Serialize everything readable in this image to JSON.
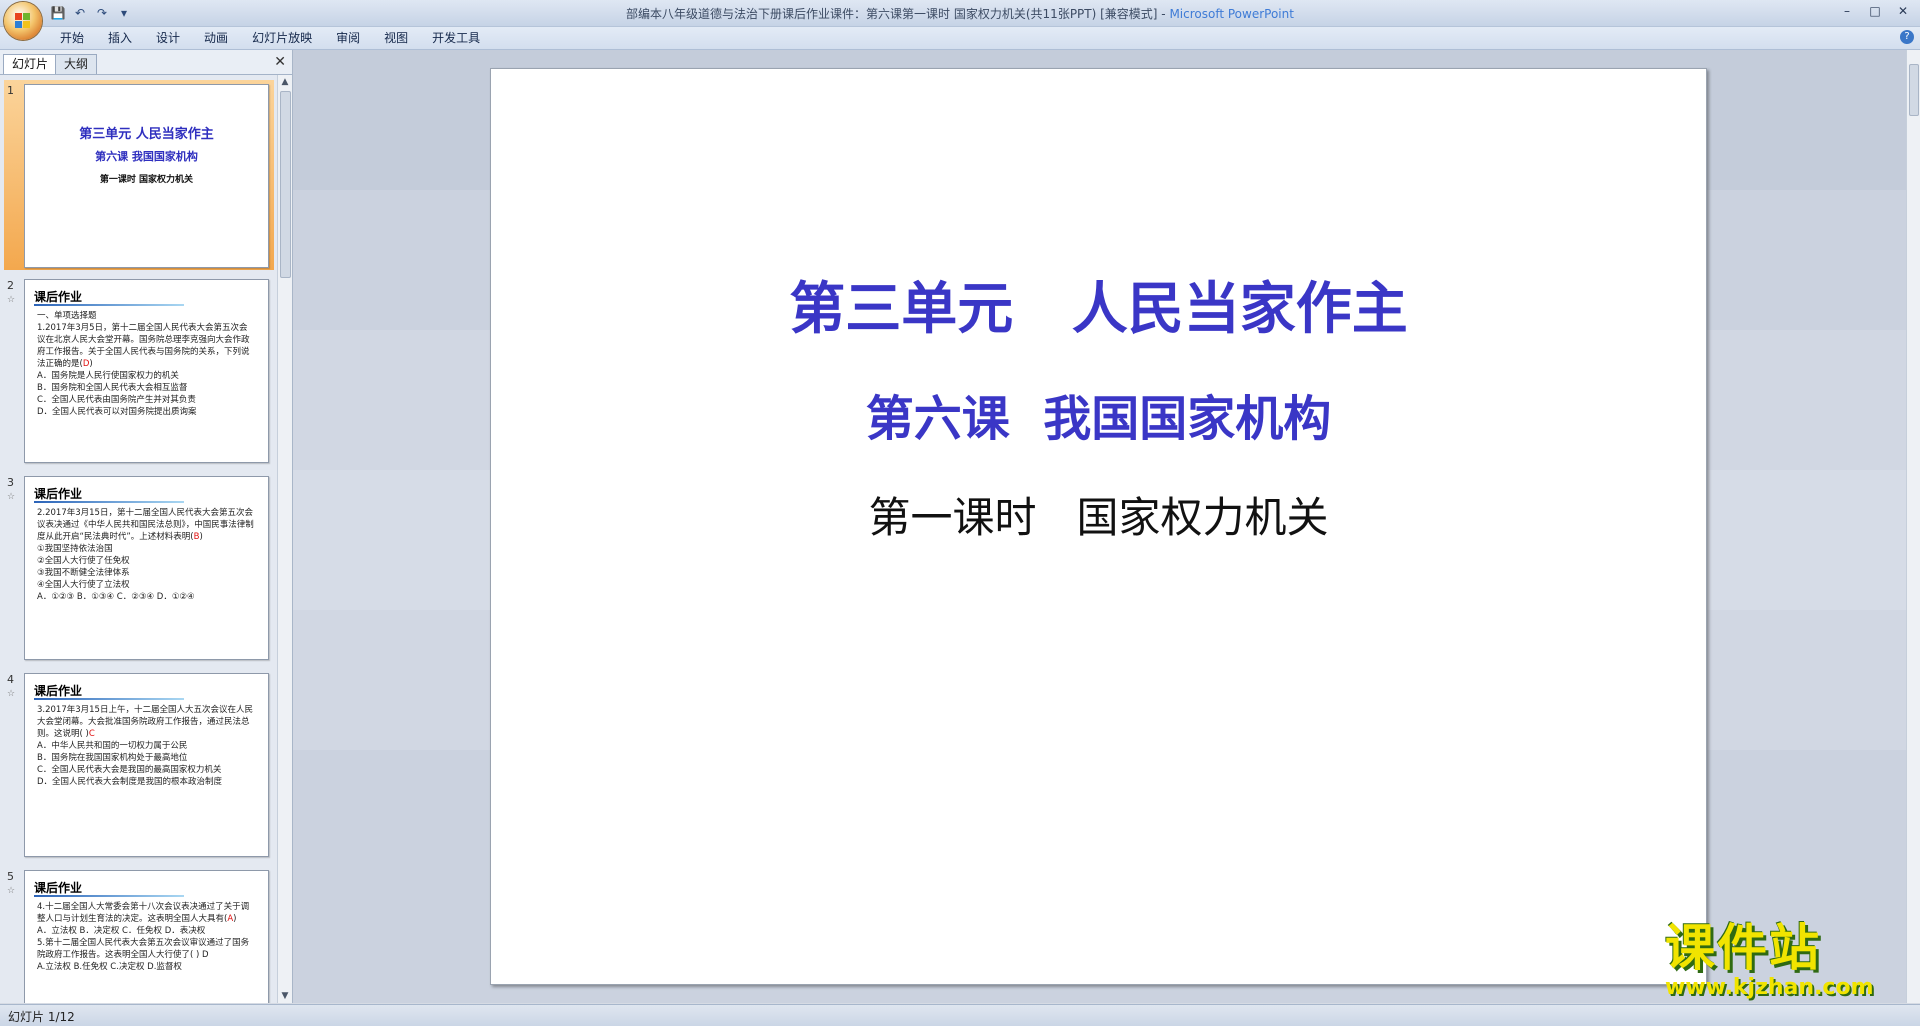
{
  "window": {
    "title": "部编本八年级道德与法治下册课后作业课件：第六课第一课时 国家权力机关(共11张PPT) [兼容模式]",
    "app_name": "Microsoft PowerPoint",
    "separator": " - "
  },
  "quick_access": {
    "save_icon": "💾",
    "undo_icon": "↶",
    "redo_icon": "↷",
    "customize_icon": "▾"
  },
  "window_controls": {
    "minimize": "–",
    "maximize": "□",
    "close": "✕"
  },
  "ribbon": {
    "tabs": [
      "开始",
      "插入",
      "设计",
      "动画",
      "幻灯片放映",
      "审阅",
      "视图",
      "开发工具"
    ],
    "help": "?"
  },
  "panel": {
    "tab_slides": "幻灯片",
    "tab_outline": "大纲",
    "close": "✕"
  },
  "thumbnails": [
    {
      "num": "1",
      "title1": "第三单元  人民当家作主",
      "title2": "第六课  我国国家机构",
      "title3": "第一课时   国家权力机关"
    },
    {
      "num": "2",
      "star": "☆",
      "head": "课后作业",
      "body_pre": "一、单项选择题\n1.2017年3月5日，第十二届全国人民代表大会第五次会议在北京人民大会堂开幕。国务院总理李克强向大会作政府工作报告。关于全国人民代表与国务院的关系，下列说法正确的是(",
      "answer": "D",
      "body_post": ")\nA．国务院是人民行使国家权力的机关\nB．国务院和全国人民代表大会相互监督\nC．全国人民代表由国务院产生并对其负责\nD．全国人民代表可以对国务院提出质询案"
    },
    {
      "num": "3",
      "star": "☆",
      "head": "课后作业",
      "body_pre": "2.2017年3月15日，第十二届全国人民代表大会第五次会议表决通过《中华人民共和国民法总则》，中国民事法律制度从此开启“民法典时代”。上述材料表明(",
      "answer": "B",
      "body_post": ")\n①我国坚持依法治国\n②全国人大行使了任免权\n③我国不断健全法律体系\n④全国人大行使了立法权\nA．①②③  B．①③④  C．②③④  D．①②④"
    },
    {
      "num": "4",
      "star": "☆",
      "head": "课后作业",
      "body_pre": "3.2017年3月15日上午，十二届全国人大五次会议在人民大会堂闭幕。大会批准国务院政府工作报告，通过民法总则。这说明(    )",
      "answer": "C",
      "body_post": "\nA．中华人民共和国的一切权力属于公民\nB．国务院在我国国家机构处于最高地位\nC．全国人民代表大会是我国的最高国家权力机关\nD．全国人民代表大会制度是我国的根本政治制度"
    },
    {
      "num": "5",
      "star": "☆",
      "head": "课后作业",
      "body_pre": "4.十二届全国人大常委会第十八次会议表决通过了关于调整人口与计划生育法的决定。这表明全国人大具有(",
      "answer": "A",
      "body_post": ")\nA．立法权  B．决定权  C．任免权  D．表决权\n5.第十二届全国人民代表大会第五次会议审议通过了国务院政府工作报告。这表明全国人大行使了(   ) D\nA.立法权  B.任免权  C.决定权  D.监督权"
    }
  ],
  "slide": {
    "title": "第三单元   人民当家作主",
    "subtitle": "第六课  我国国家机构",
    "line3": "第一课时   国家权力机关"
  },
  "status": {
    "slide_counter": "幻灯片 1/12"
  },
  "watermark": {
    "cn": "课件站",
    "url": "www.kjzhan.com"
  }
}
